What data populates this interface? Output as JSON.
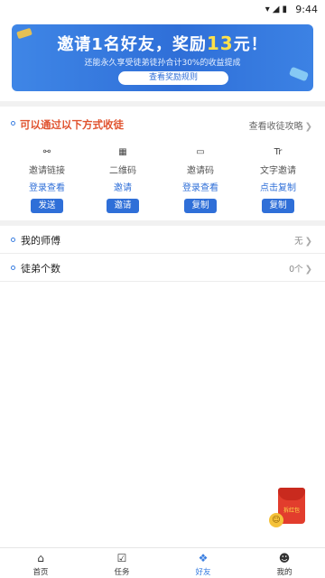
{
  "status_bar": {
    "time": "9:44",
    "icons": [
      "wifi-icon",
      "signal-icon",
      "battery-icon"
    ]
  },
  "banner": {
    "headline_prefix": "邀请1名好友，奖励",
    "amount": "13",
    "headline_suffix": "元！",
    "subtitle": "还能永久享受徒弟徒孙合计30%的收益提成",
    "rules_button": "查看奖励规则",
    "accent_color": "#ffe14a"
  },
  "methods_section": {
    "title": "可以通过以下方式收徒",
    "link": "查看收徒攻略",
    "items": [
      {
        "icon": "link-icon",
        "name": "邀请链接",
        "sub": "登录查看",
        "button": "发送"
      },
      {
        "icon": "qrcode-icon",
        "name": "二维码",
        "sub": "邀请",
        "button": "邀请"
      },
      {
        "icon": "code-icon",
        "name": "邀请码",
        "sub": "登录查看",
        "button": "复制"
      },
      {
        "icon": "text-icon",
        "name": "文字邀请",
        "sub": "点击复制",
        "button": "复制"
      }
    ]
  },
  "info_rows": [
    {
      "label": "我的师傅",
      "value": "无"
    },
    {
      "label": "徒弟个数",
      "value": "0个"
    }
  ],
  "floating_envelope": {
    "label": "拆红包"
  },
  "tab_bar": {
    "tabs": [
      {
        "icon": "home-icon",
        "label": "首页",
        "active": false
      },
      {
        "icon": "task-icon",
        "label": "任务",
        "active": false
      },
      {
        "icon": "friends-icon",
        "label": "好友",
        "active": true
      },
      {
        "icon": "profile-icon",
        "label": "我的",
        "active": false
      }
    ]
  },
  "colors": {
    "primary": "#2f6fd8",
    "section_title": "#e0532f",
    "active_tab": "#3a7ee0"
  }
}
